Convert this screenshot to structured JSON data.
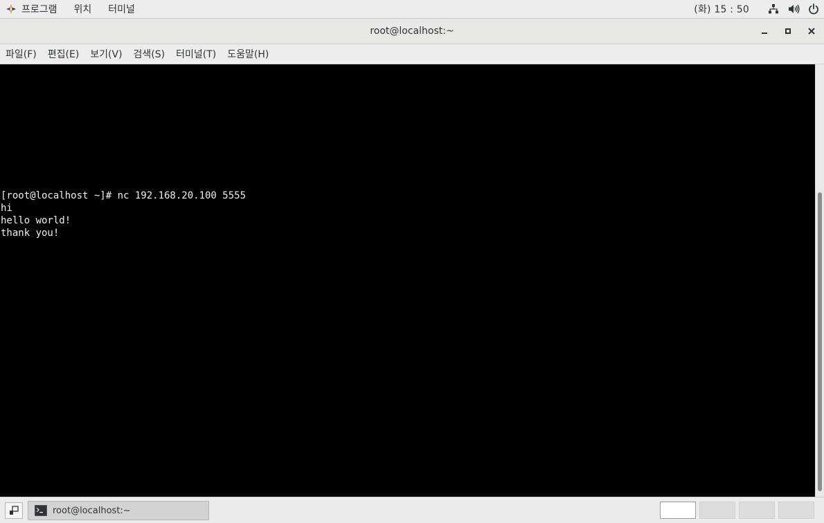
{
  "top_panel": {
    "menu": [
      "프로그램",
      "위치",
      "터미널"
    ],
    "clock": "(화) 15 : 50"
  },
  "window": {
    "title": "root@localhost:~"
  },
  "menubar": [
    "파일(F)",
    "편집(E)",
    "보기(V)",
    "검색(S)",
    "터미널(T)",
    "도움말(H)"
  ],
  "terminal": {
    "lines": [
      "[root@localhost ~]# nc 192.168.20.100 5555",
      "hi",
      "hello world!",
      "thank you!"
    ]
  },
  "taskbar": {
    "task_label": "root@localhost:~",
    "workspaces": 4,
    "active_workspace": 1
  },
  "colors": {
    "terminal_bg": "#000000",
    "terminal_fg": "#f0f0f0",
    "panel_bg": "#ededed"
  }
}
